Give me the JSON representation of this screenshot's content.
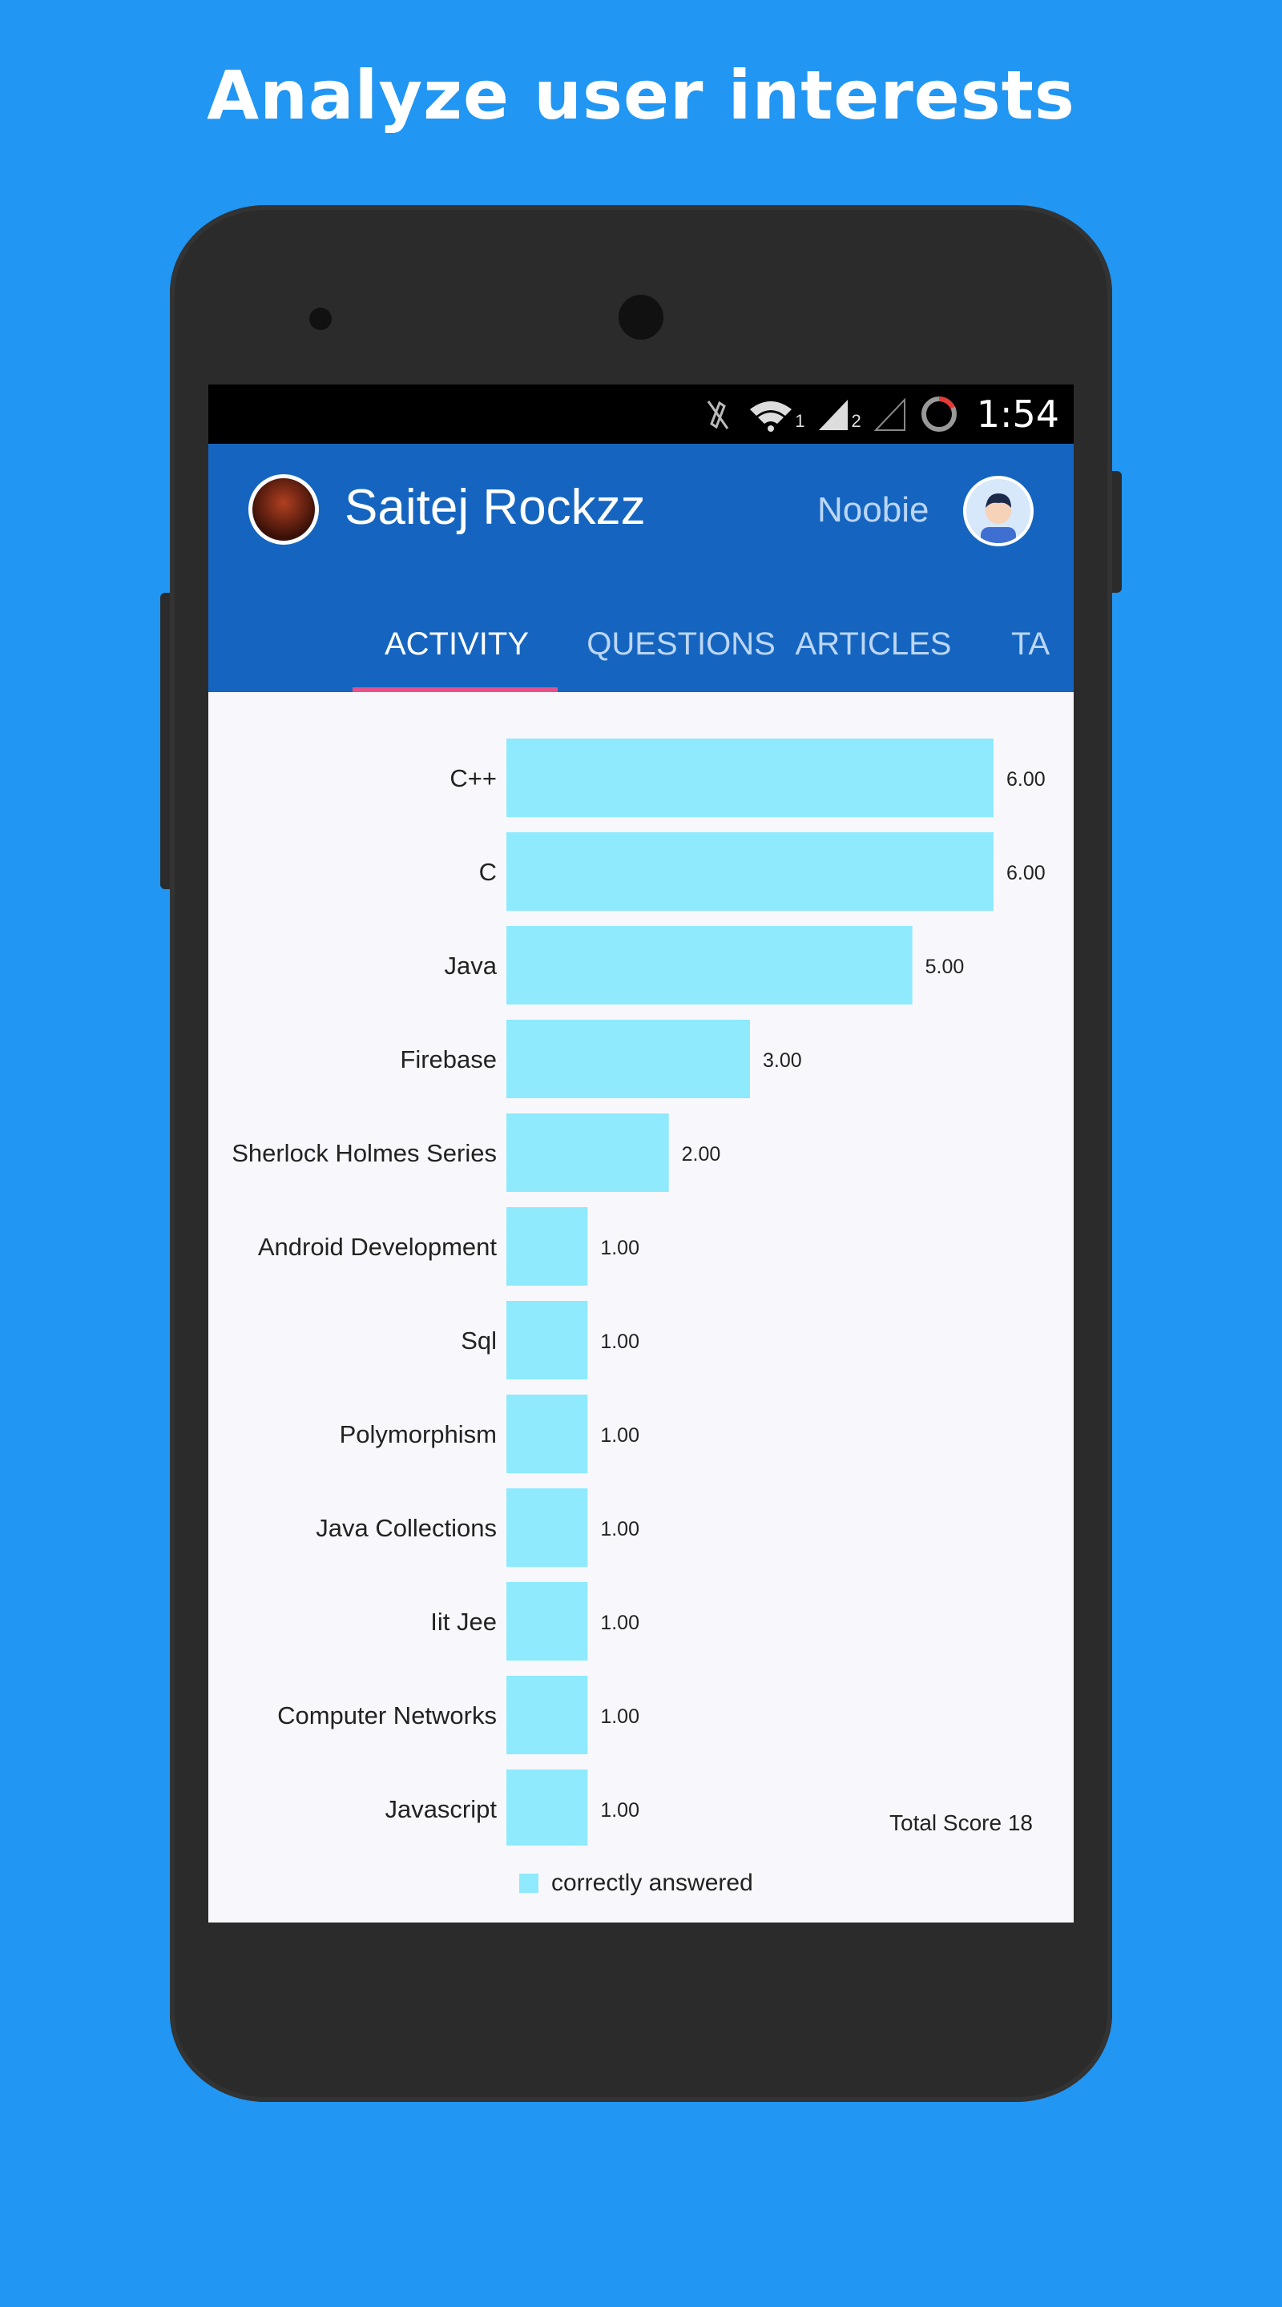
{
  "headline": "Analyze user interests",
  "status": {
    "time": "1:54",
    "wifi_sub": "1",
    "signal_sub": "2"
  },
  "profile": {
    "name": "Saitej Rockzz",
    "rank": "Noobie"
  },
  "tabs": [
    "ACTIVITY",
    "QUESTIONS",
    "ARTICLES",
    "TA"
  ],
  "icons": {
    "mute": "mute-icon",
    "wifi": "wifi-icon",
    "signal": "signal-icon",
    "signal2": "signal-empty-icon",
    "battery": "battery-ring-icon"
  },
  "colors": {
    "background": "#2196F3",
    "appbar": "#1565C0",
    "bar": "#8eeafc",
    "indicator": "#e8508a"
  },
  "chart_data": {
    "type": "bar",
    "orientation": "horizontal",
    "categories": [
      "C++",
      "C",
      "Java",
      "Firebase",
      "Sherlock Holmes Series",
      "Android Development",
      "Sql",
      "Polymorphism",
      "Java Collections",
      "Iit Jee",
      "Computer Networks",
      "Javascript"
    ],
    "values": [
      6,
      6,
      5,
      3,
      2,
      1,
      1,
      1,
      1,
      1,
      1,
      1
    ],
    "value_labels": [
      "6.00",
      "6.00",
      "5.00",
      "3.00",
      "2.00",
      "1.00",
      "1.00",
      "1.00",
      "1.00",
      "1.00",
      "1.00",
      "1.00"
    ],
    "series": [
      {
        "name": "correctly answered",
        "values": [
          6,
          6,
          5,
          3,
          2,
          1,
          1,
          1,
          1,
          1,
          1,
          1
        ]
      }
    ],
    "xlim": [
      0,
      6
    ],
    "grid": false,
    "legend": "bottom"
  },
  "total_score": "Total Score 18",
  "legend_label": "correctly answered"
}
